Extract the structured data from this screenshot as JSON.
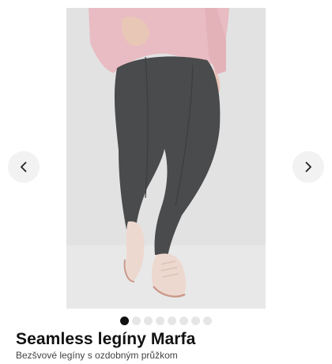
{
  "product": {
    "title": "Seamless legíny Marfa",
    "subtitle": "Bezšvové legíny s ozdobným průžkom",
    "image_alt": "Seamless legíny Marfa"
  },
  "carousel": {
    "prev_icon": "chevron-left-icon",
    "next_icon": "chevron-right-icon",
    "slide_count": 8,
    "active_index": 0
  },
  "colors": {
    "legging": "#4a4b4d",
    "sweater": "#e8bcc2",
    "shoe": "#edd8cf",
    "background": "#e1e1e2"
  }
}
